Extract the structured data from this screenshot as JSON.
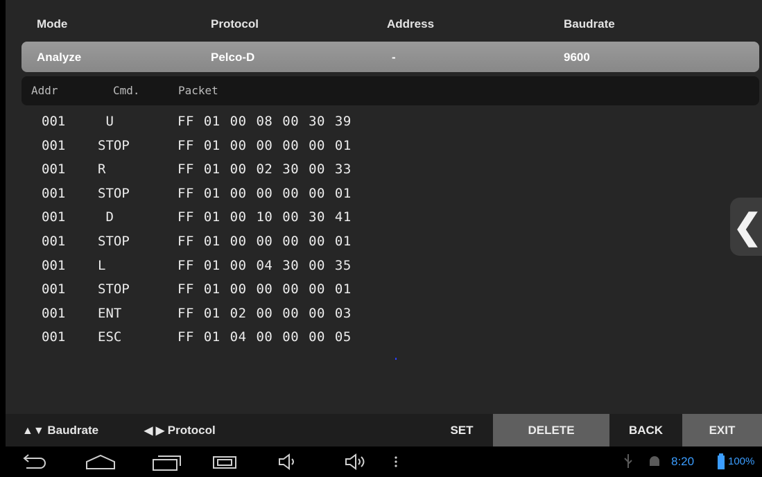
{
  "header": {
    "mode_label": "Mode",
    "protocol_label": "Protocol",
    "address_label": "Address",
    "baudrate_label": "Baudrate"
  },
  "selected": {
    "mode": "Analyze",
    "protocol": "Pelco-D",
    "address": "-",
    "baudrate": "9600"
  },
  "columns": {
    "addr": "Addr",
    "cmd": "Cmd.",
    "packet": "Packet"
  },
  "rows": [
    {
      "addr": "001",
      "cmd": " U",
      "packet": "FF 01 00 08 00 30 39"
    },
    {
      "addr": "001",
      "cmd": "STOP",
      "packet": "FF 01 00 00 00 00 01"
    },
    {
      "addr": "001",
      "cmd": "R",
      "packet": "FF 01 00 02 30 00 33"
    },
    {
      "addr": "001",
      "cmd": "STOP",
      "packet": "FF 01 00 00 00 00 01"
    },
    {
      "addr": "001",
      "cmd": " D",
      "packet": "FF 01 00 10 00 30 41"
    },
    {
      "addr": "001",
      "cmd": "STOP",
      "packet": "FF 01 00 00 00 00 01"
    },
    {
      "addr": "001",
      "cmd": "L",
      "packet": "FF 01 00 04 30 00 35"
    },
    {
      "addr": "001",
      "cmd": "STOP",
      "packet": "FF 01 00 00 00 00 01"
    },
    {
      "addr": "001",
      "cmd": "ENT",
      "packet": "FF 01 02 00 00 00 03"
    },
    {
      "addr": "001",
      "cmd": "ESC",
      "packet": "FF 01 04 00 00 00 05"
    }
  ],
  "keybar": {
    "baudrate_hint": "Baudrate",
    "protocol_hint": "Protocol",
    "set": "SET",
    "delete": "DELETE",
    "back": "BACK",
    "exit": "EXIT"
  },
  "status": {
    "time": "8:20",
    "battery": "100%"
  },
  "icons": {
    "pull_tab": "chevron-left-icon",
    "up_down": "up-down-arrows",
    "left_right": "left-right-arrows"
  },
  "colors": {
    "status_blue": "#3b9dff",
    "selected_row": "#9a9a9a",
    "highlight_key": "#5f5f5f"
  }
}
